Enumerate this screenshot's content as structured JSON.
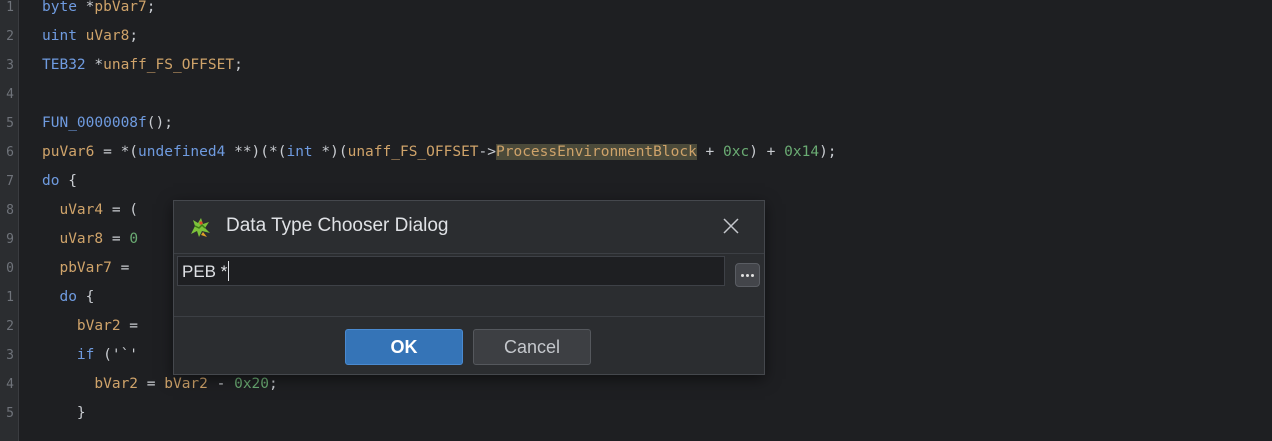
{
  "editor": {
    "lines": [
      {
        "num": "1",
        "tokens": [
          {
            "t": "byte",
            "c": "ty"
          },
          {
            "t": " *",
            "c": "op"
          },
          {
            "t": "pbVar7",
            "c": "var"
          },
          {
            "t": ";",
            "c": "op"
          }
        ]
      },
      {
        "num": "2",
        "tokens": [
          {
            "t": "uint",
            "c": "ty"
          },
          {
            "t": " ",
            "c": "op"
          },
          {
            "t": "uVar8",
            "c": "var"
          },
          {
            "t": ";",
            "c": "op"
          }
        ]
      },
      {
        "num": "3",
        "tokens": [
          {
            "t": "TEB32",
            "c": "ty"
          },
          {
            "t": " *",
            "c": "op"
          },
          {
            "t": "unaff_FS_OFFSET",
            "c": "var"
          },
          {
            "t": ";",
            "c": "op"
          }
        ]
      },
      {
        "num": "4",
        "tokens": []
      },
      {
        "num": "5",
        "tokens": [
          {
            "t": "FUN_0000008f",
            "c": "fn"
          },
          {
            "t": "();",
            "c": "op"
          }
        ]
      },
      {
        "num": "6",
        "tokens": [
          {
            "t": "puVar6",
            "c": "var"
          },
          {
            "t": " = *(",
            "c": "op"
          },
          {
            "t": "undefined4",
            "c": "ty"
          },
          {
            "t": " **)(*(",
            "c": "op"
          },
          {
            "t": "int",
            "c": "ty"
          },
          {
            "t": " *)(",
            "c": "op"
          },
          {
            "t": "unaff_FS_OFFSET",
            "c": "var"
          },
          {
            "t": "->",
            "c": "op"
          },
          {
            "t": "ProcessEnvironmentBlock",
            "c": "hl"
          },
          {
            "t": " + ",
            "c": "op"
          },
          {
            "t": "0xc",
            "c": "num"
          },
          {
            "t": ") + ",
            "c": "op"
          },
          {
            "t": "0x14",
            "c": "num"
          },
          {
            "t": ");",
            "c": "op"
          }
        ]
      },
      {
        "num": "7",
        "tokens": [
          {
            "t": "do",
            "c": "kw"
          },
          {
            "t": " {",
            "c": "op"
          }
        ]
      },
      {
        "num": "8",
        "tokens": [
          {
            "t": "  uVar4",
            "c": "var"
          },
          {
            "t": " = (",
            "c": "op"
          }
        ]
      },
      {
        "num": "9",
        "tokens": [
          {
            "t": "  uVar8",
            "c": "var"
          },
          {
            "t": " = ",
            "c": "op"
          },
          {
            "t": "0",
            "c": "num"
          }
        ]
      },
      {
        "num": "0",
        "tokens": [
          {
            "t": "  pbVar7",
            "c": "var"
          },
          {
            "t": " = ",
            "c": "op"
          }
        ]
      },
      {
        "num": "1",
        "tokens": [
          {
            "t": "  do",
            "c": "kw"
          },
          {
            "t": " {",
            "c": "op"
          }
        ]
      },
      {
        "num": "2",
        "tokens": [
          {
            "t": "    bVar2",
            "c": "var"
          },
          {
            "t": " =",
            "c": "op"
          }
        ]
      },
      {
        "num": "3",
        "tokens": [
          {
            "t": "    if",
            "c": "kw"
          },
          {
            "t": " ('`'",
            "c": "op"
          }
        ]
      },
      {
        "num": "4",
        "tokens": [
          {
            "t": "      bVar2",
            "c": "var"
          },
          {
            "t": " = ",
            "c": "op"
          },
          {
            "t": "bVar2",
            "c": "var"
          },
          {
            "t": " - ",
            "c": "op"
          },
          {
            "t": "0x20",
            "c": "num"
          },
          {
            "t": ";",
            "c": "op"
          }
        ]
      },
      {
        "num": "5",
        "tokens": [
          {
            "t": "    }",
            "c": "op"
          }
        ]
      }
    ]
  },
  "dialog": {
    "title": "Data Type Chooser Dialog",
    "input_value": "PEB *",
    "ok_label": "OK",
    "cancel_label": "Cancel",
    "icons": {
      "app": "dragon-icon",
      "close": "close-icon",
      "browse": "ellipsis-icon"
    }
  }
}
